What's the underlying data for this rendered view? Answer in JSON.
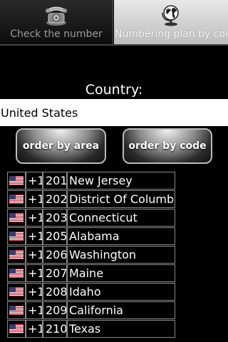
{
  "tabs": [
    {
      "label": "Check the number",
      "icon": "telephone-icon",
      "active": false
    },
    {
      "label": "Numbering plan by count",
      "icon": "globe-icon",
      "active": true
    }
  ],
  "country": {
    "label": "Country:",
    "value": "United States"
  },
  "buttons": {
    "order_by_area": "order by area",
    "order_by_code": "order by code"
  },
  "rows": [
    {
      "country_code": "+1",
      "area_code": "201",
      "region": "New Jersey"
    },
    {
      "country_code": "+1",
      "area_code": "202",
      "region": "District Of Columbia"
    },
    {
      "country_code": "+1",
      "area_code": "203",
      "region": "Connecticut"
    },
    {
      "country_code": "+1",
      "area_code": "205",
      "region": "Alabama"
    },
    {
      "country_code": "+1",
      "area_code": "206",
      "region": "Washington"
    },
    {
      "country_code": "+1",
      "area_code": "207",
      "region": "Maine"
    },
    {
      "country_code": "+1",
      "area_code": "208",
      "region": "Idaho"
    },
    {
      "country_code": "+1",
      "area_code": "209",
      "region": "California"
    },
    {
      "country_code": "+1",
      "area_code": "210",
      "region": "Texas"
    }
  ],
  "colors": {
    "background": "#000000",
    "active_tab": "#cfcfcf",
    "flag_blue": "#3c3b6e",
    "flag_red": "#b22234"
  }
}
